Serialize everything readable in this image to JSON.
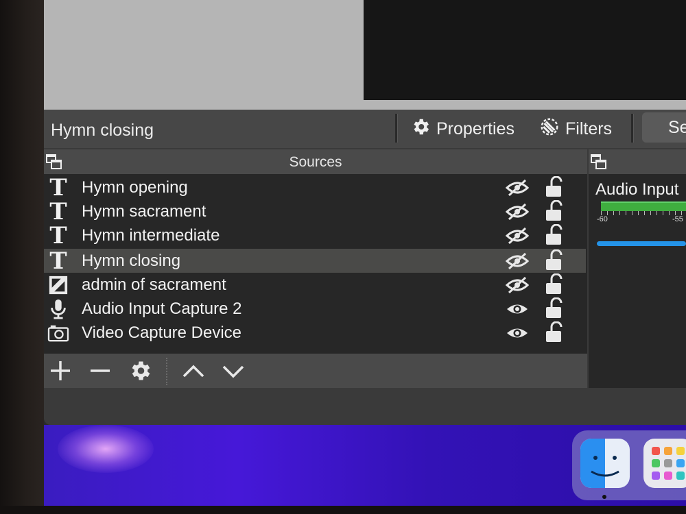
{
  "context_bar": {
    "current_source": "Hymn closing",
    "properties_label": "Properties",
    "filters_label": "Filters",
    "scene_tab_partial": "Se"
  },
  "sources": {
    "title": "Sources",
    "items": [
      {
        "label": "Hymn opening",
        "type_icon": "text-icon",
        "visible": false,
        "locked": false
      },
      {
        "label": "Hymn sacrament",
        "type_icon": "text-icon",
        "visible": false,
        "locked": false
      },
      {
        "label": "Hymn intermediate",
        "type_icon": "text-icon",
        "visible": false,
        "locked": false
      },
      {
        "label": "Hymn closing",
        "type_icon": "text-icon",
        "visible": false,
        "locked": false,
        "selected": true
      },
      {
        "label": "admin of sacrament",
        "type_icon": "image-icon",
        "visible": false,
        "locked": false
      },
      {
        "label": "Audio Input Capture 2",
        "type_icon": "microphone-icon",
        "visible": true,
        "locked": false
      },
      {
        "label": "Video Capture Device",
        "type_icon": "camera-icon",
        "visible": true,
        "locked": false
      }
    ],
    "toolbar": [
      "add-icon",
      "remove-icon",
      "gear-icon",
      "move-up-icon",
      "move-down-icon"
    ]
  },
  "audio_mixer": {
    "channel_label": "Audio Input",
    "tick_labels": [
      "-60",
      "-55"
    ]
  },
  "colors": {
    "meter_green": "#3fae3f",
    "volume_blue": "#2493e8",
    "desktop_purple": "#4618d8"
  }
}
